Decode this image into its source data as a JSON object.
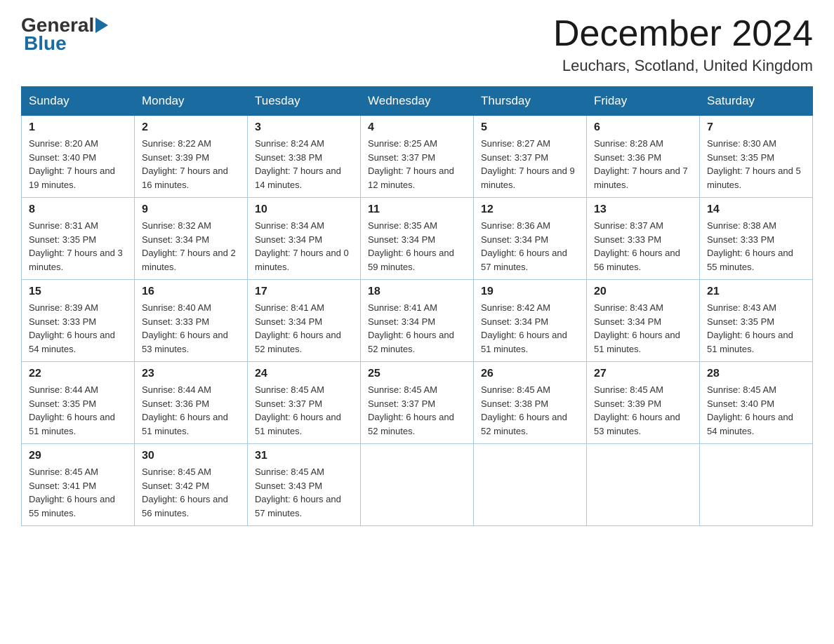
{
  "header": {
    "logo_general": "General",
    "logo_blue": "Blue",
    "title": "December 2024",
    "location": "Leuchars, Scotland, United Kingdom"
  },
  "weekdays": [
    "Sunday",
    "Monday",
    "Tuesday",
    "Wednesday",
    "Thursday",
    "Friday",
    "Saturday"
  ],
  "weeks": [
    [
      {
        "day": "1",
        "sunrise": "8:20 AM",
        "sunset": "3:40 PM",
        "daylight": "7 hours and 19 minutes."
      },
      {
        "day": "2",
        "sunrise": "8:22 AM",
        "sunset": "3:39 PM",
        "daylight": "7 hours and 16 minutes."
      },
      {
        "day": "3",
        "sunrise": "8:24 AM",
        "sunset": "3:38 PM",
        "daylight": "7 hours and 14 minutes."
      },
      {
        "day": "4",
        "sunrise": "8:25 AM",
        "sunset": "3:37 PM",
        "daylight": "7 hours and 12 minutes."
      },
      {
        "day": "5",
        "sunrise": "8:27 AM",
        "sunset": "3:37 PM",
        "daylight": "7 hours and 9 minutes."
      },
      {
        "day": "6",
        "sunrise": "8:28 AM",
        "sunset": "3:36 PM",
        "daylight": "7 hours and 7 minutes."
      },
      {
        "day": "7",
        "sunrise": "8:30 AM",
        "sunset": "3:35 PM",
        "daylight": "7 hours and 5 minutes."
      }
    ],
    [
      {
        "day": "8",
        "sunrise": "8:31 AM",
        "sunset": "3:35 PM",
        "daylight": "7 hours and 3 minutes."
      },
      {
        "day": "9",
        "sunrise": "8:32 AM",
        "sunset": "3:34 PM",
        "daylight": "7 hours and 2 minutes."
      },
      {
        "day": "10",
        "sunrise": "8:34 AM",
        "sunset": "3:34 PM",
        "daylight": "7 hours and 0 minutes."
      },
      {
        "day": "11",
        "sunrise": "8:35 AM",
        "sunset": "3:34 PM",
        "daylight": "6 hours and 59 minutes."
      },
      {
        "day": "12",
        "sunrise": "8:36 AM",
        "sunset": "3:34 PM",
        "daylight": "6 hours and 57 minutes."
      },
      {
        "day": "13",
        "sunrise": "8:37 AM",
        "sunset": "3:33 PM",
        "daylight": "6 hours and 56 minutes."
      },
      {
        "day": "14",
        "sunrise": "8:38 AM",
        "sunset": "3:33 PM",
        "daylight": "6 hours and 55 minutes."
      }
    ],
    [
      {
        "day": "15",
        "sunrise": "8:39 AM",
        "sunset": "3:33 PM",
        "daylight": "6 hours and 54 minutes."
      },
      {
        "day": "16",
        "sunrise": "8:40 AM",
        "sunset": "3:33 PM",
        "daylight": "6 hours and 53 minutes."
      },
      {
        "day": "17",
        "sunrise": "8:41 AM",
        "sunset": "3:34 PM",
        "daylight": "6 hours and 52 minutes."
      },
      {
        "day": "18",
        "sunrise": "8:41 AM",
        "sunset": "3:34 PM",
        "daylight": "6 hours and 52 minutes."
      },
      {
        "day": "19",
        "sunrise": "8:42 AM",
        "sunset": "3:34 PM",
        "daylight": "6 hours and 51 minutes."
      },
      {
        "day": "20",
        "sunrise": "8:43 AM",
        "sunset": "3:34 PM",
        "daylight": "6 hours and 51 minutes."
      },
      {
        "day": "21",
        "sunrise": "8:43 AM",
        "sunset": "3:35 PM",
        "daylight": "6 hours and 51 minutes."
      }
    ],
    [
      {
        "day": "22",
        "sunrise": "8:44 AM",
        "sunset": "3:35 PM",
        "daylight": "6 hours and 51 minutes."
      },
      {
        "day": "23",
        "sunrise": "8:44 AM",
        "sunset": "3:36 PM",
        "daylight": "6 hours and 51 minutes."
      },
      {
        "day": "24",
        "sunrise": "8:45 AM",
        "sunset": "3:37 PM",
        "daylight": "6 hours and 51 minutes."
      },
      {
        "day": "25",
        "sunrise": "8:45 AM",
        "sunset": "3:37 PM",
        "daylight": "6 hours and 52 minutes."
      },
      {
        "day": "26",
        "sunrise": "8:45 AM",
        "sunset": "3:38 PM",
        "daylight": "6 hours and 52 minutes."
      },
      {
        "day": "27",
        "sunrise": "8:45 AM",
        "sunset": "3:39 PM",
        "daylight": "6 hours and 53 minutes."
      },
      {
        "day": "28",
        "sunrise": "8:45 AM",
        "sunset": "3:40 PM",
        "daylight": "6 hours and 54 minutes."
      }
    ],
    [
      {
        "day": "29",
        "sunrise": "8:45 AM",
        "sunset": "3:41 PM",
        "daylight": "6 hours and 55 minutes."
      },
      {
        "day": "30",
        "sunrise": "8:45 AM",
        "sunset": "3:42 PM",
        "daylight": "6 hours and 56 minutes."
      },
      {
        "day": "31",
        "sunrise": "8:45 AM",
        "sunset": "3:43 PM",
        "daylight": "6 hours and 57 minutes."
      },
      null,
      null,
      null,
      null
    ]
  ]
}
